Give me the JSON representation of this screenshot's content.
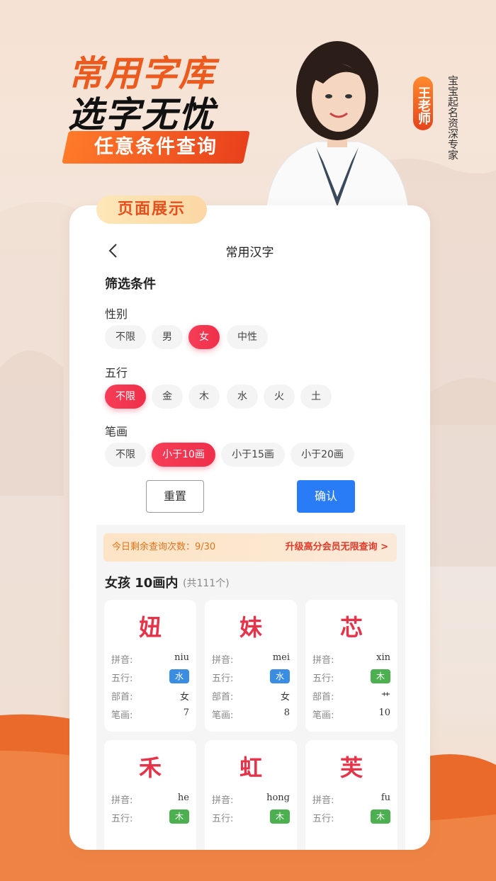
{
  "banner": {
    "title_line1": "常用字库",
    "title_line2": "选字无忧",
    "ribbon": "任意条件查询",
    "teacher_name": "王老师",
    "teacher_desc": "宝宝起名资深专家"
  },
  "section_tab": "页面展示",
  "nav": {
    "title": "常用汉字"
  },
  "filter": {
    "heading": "筛选条件",
    "gender": {
      "label": "性别",
      "options": [
        "不限",
        "男",
        "女",
        "中性"
      ],
      "selected": "女"
    },
    "wuxing": {
      "label": "五行",
      "options": [
        "不限",
        "金",
        "木",
        "水",
        "火",
        "土"
      ],
      "selected": "不限"
    },
    "strokes": {
      "label": "笔画",
      "options": [
        "不限",
        "小于10画",
        "小于15画",
        "小于20画"
      ],
      "selected": "小于10画"
    }
  },
  "actions": {
    "reset": "重置",
    "confirm": "确认"
  },
  "quota": {
    "text": "今日剩余查询次数：9/30",
    "upgrade": "升级高分会员无限查询 >"
  },
  "results": {
    "title": "女孩 10画内",
    "count": "(共111个)",
    "field_labels": {
      "pinyin": "拼音:",
      "wuxing": "五行:",
      "radical": "部首:",
      "strokes": "笔画:"
    },
    "items": [
      {
        "char": "妞",
        "pinyin": "niu",
        "wuxing": "水",
        "radical": "女",
        "strokes": "7"
      },
      {
        "char": "妹",
        "pinyin": "mei",
        "wuxing": "水",
        "radical": "女",
        "strokes": "8"
      },
      {
        "char": "芯",
        "pinyin": "xin",
        "wuxing": "木",
        "radical": "艹",
        "strokes": "10"
      },
      {
        "char": "禾",
        "pinyin": "he",
        "wuxing": "木"
      },
      {
        "char": "虹",
        "pinyin": "hong",
        "wuxing": "木"
      },
      {
        "char": "芙",
        "pinyin": "fu",
        "wuxing": "木"
      }
    ]
  },
  "colors": {
    "accent": "#ef2f4a",
    "confirm": "#2a7cf6",
    "water": "#3a8de0",
    "wood": "#4caf50",
    "brand_orange": "#ec5a1e"
  }
}
